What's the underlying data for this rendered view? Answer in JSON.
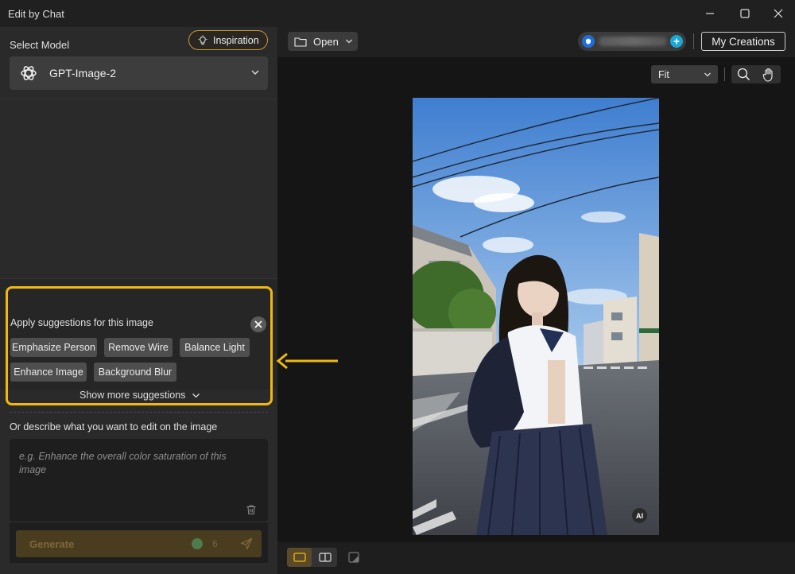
{
  "window": {
    "title": "Edit by Chat"
  },
  "left_panel": {
    "select_model_label": "Select Model",
    "inspiration_label": "Inspiration",
    "model": {
      "selected": "GPT-Image-2"
    },
    "suggestions": {
      "title": "Apply suggestions for this image",
      "chips": [
        "Emphasize Person",
        "Remove Wire",
        "Balance Light",
        "Enhance Image",
        "Background Blur"
      ],
      "show_more": "Show more suggestions"
    },
    "describe": {
      "label": "Or describe what you want to edit on the image",
      "placeholder": "e.g. Enhance the overall color saturation of this image"
    },
    "generate": {
      "label": "Generate",
      "credits": "6"
    }
  },
  "toolbar": {
    "open_label": "Open",
    "my_creations_label": "My Creations"
  },
  "canvas": {
    "zoom_mode": "Fit",
    "ai_badge": "AI"
  },
  "colors": {
    "accent": "#f0b90b",
    "inspiration_border": "#c39a35",
    "generate_bg": "#4a3c1f"
  },
  "icons": [
    "openai-logo-icon",
    "lightbulb-icon",
    "chevron-down-icon",
    "close-icon",
    "trash-icon",
    "send-icon",
    "folder-icon",
    "shield-icon",
    "plus-icon",
    "search-icon",
    "hand-icon",
    "single-view-icon",
    "split-view-icon",
    "compare-icon",
    "minimize-icon",
    "maximize-icon",
    "window-close-icon",
    "arrow-left-icon"
  ]
}
